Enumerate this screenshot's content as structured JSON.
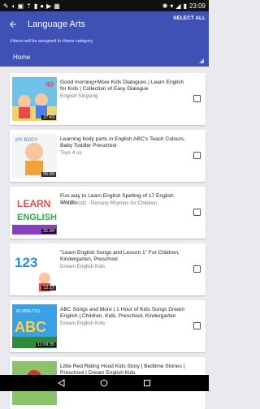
{
  "status_bar": {
    "time": "23:09"
  },
  "app_bar": {
    "title": "Language Arts",
    "select_all": "SELECT ALL",
    "subtitle": "Videos will be assigned to Home category",
    "category": "Home"
  },
  "videos": [
    {
      "title": "Good morning+More Kids Dialogues | Learn English for Kids | Collection of Easy Dialogue",
      "channel": "English Singsing",
      "duration": "37:43"
    },
    {
      "title": "Learning body parts in English ABC's Teach Colours, Baby Toddler Preschool",
      "channel": "Toys 4 us",
      "duration": "05:59"
    },
    {
      "title": "Fun way to Learn English Spelling of 17 English Words",
      "channel": "HooplaKidz - Nursery Rhymes for Children",
      "duration": "31:34"
    },
    {
      "title": "\"Learn English Songs and Lesson 1\" For Children, Kindergarten, Preschool",
      "channel": "Dream English Kids",
      "duration": "12:17"
    },
    {
      "title": "ABC Songs and More | 1 Hour of Kids Songs Dream English | Children, Kids, Preschool, Kindergarten",
      "channel": "Dream English Kids",
      "duration": "11:09:35"
    },
    {
      "title": "Little Red Riding Hood Kids Story | Bedtime Stories | Preschool | Dream English Kids",
      "channel": "",
      "duration": ""
    }
  ]
}
